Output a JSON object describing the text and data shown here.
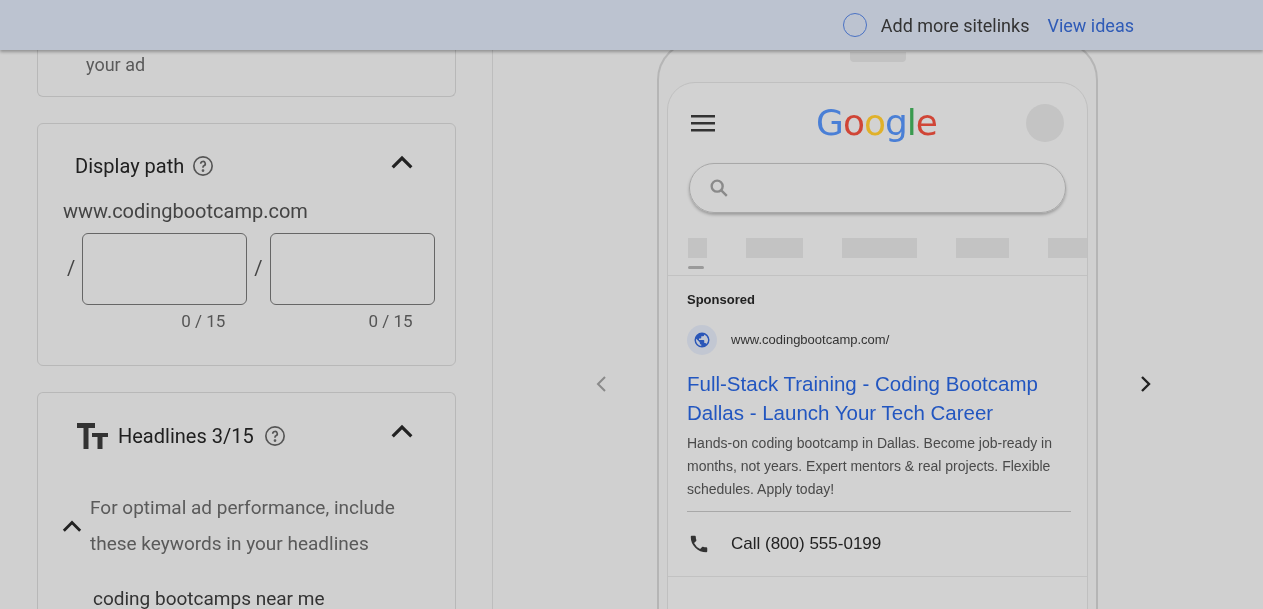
{
  "top_bar": {
    "sitelinks_option": {
      "label": "Add more sitelinks",
      "checked": false
    },
    "link": "View ideas"
  },
  "cards": [
    {
      "kind": "tail",
      "text": "your ad"
    },
    {
      "kind": "display_path",
      "title": "Display path",
      "expanded": true,
      "domain": "www.codingbootcamp.com",
      "separator": "/",
      "paths": [
        {
          "counter": "0 / 15"
        },
        {
          "counter": "0 / 15"
        }
      ]
    },
    {
      "kind": "headlines",
      "title": "Headlines 3/15",
      "expanded": true,
      "tip": "For optimal ad performance, include these keywords in your headlines",
      "tip_expanded": true,
      "keywords": [
        "coding bootcamps near me"
      ]
    }
  ],
  "preview": {
    "logo_text": "Google",
    "ad": {
      "label": "Sponsored",
      "url": "www.codingbootcamp.com/",
      "headline": "Full-Stack Training - Coding Bootcamp Dallas - Launch Your Tech Career",
      "description": "Hands-on coding bootcamp in Dallas. Become job-ready in months, not years. Expert mentors & real projects. Flexible schedules. Apply today!",
      "call": "Call (800) 555-0199"
    }
  }
}
